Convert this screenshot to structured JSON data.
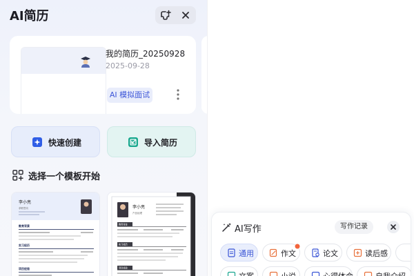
{
  "app": {
    "title": "AI简历"
  },
  "resume": {
    "name": "我的简历_20250928",
    "date": "2025-09-28",
    "tag": "AI 模拟面试"
  },
  "actions": {
    "quick_create": "快速创建",
    "import_resume": "导入简历"
  },
  "templates": {
    "section_title": "选择一个模板开始",
    "items": [
      {
        "name": "李小亮",
        "subtitle": "求职意向",
        "sections": [
          "教育背景",
          "实习经历",
          "项目经验"
        ]
      },
      {
        "name": "李小亮",
        "subtitle": "产品经理",
        "sections": [
          "教育背景",
          "实习经历",
          "项目经验"
        ]
      }
    ]
  },
  "ai_write": {
    "title": "AI写作",
    "history": "写作记录",
    "chips": [
      {
        "label": "通用",
        "icon": "document-icon",
        "active": true
      },
      {
        "label": "作文",
        "icon": "pen-icon",
        "badge": true
      },
      {
        "label": "论文",
        "icon": "paper-icon"
      },
      {
        "label": "读后感",
        "icon": "book-icon"
      },
      {
        "label": "文案",
        "icon": "copy-icon"
      },
      {
        "label": "小说",
        "icon": "novel-icon"
      },
      {
        "label": "心得体会",
        "icon": "heart-icon"
      },
      {
        "label": "自我介绍",
        "icon": "user-icon"
      }
    ]
  },
  "colors": {
    "accent": "#3d56d8",
    "teal": "#17a58f",
    "orange": "#e8703a"
  }
}
